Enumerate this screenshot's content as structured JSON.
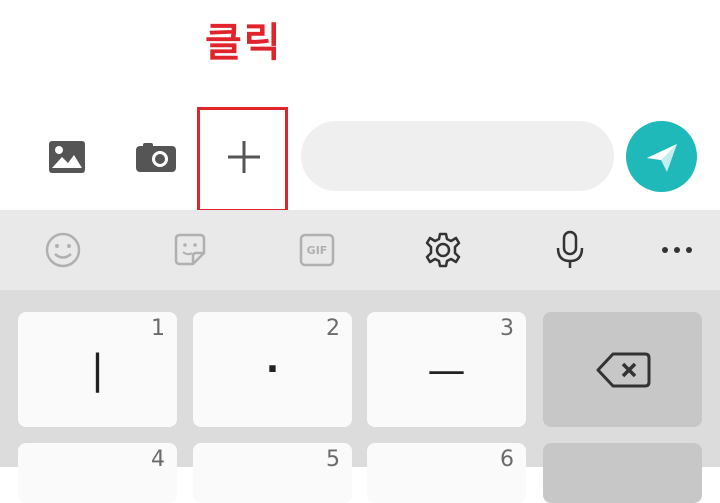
{
  "annotation": {
    "text": "클릭"
  },
  "composer": {
    "icons": [
      "image-icon",
      "camera-icon",
      "plus-icon"
    ],
    "message_placeholder": "",
    "send_icon": "send-icon",
    "accent": "#1fb9b9"
  },
  "keyboard_toolbar": {
    "items": [
      "emoji-icon",
      "sticker-icon",
      "gif-icon",
      "settings-icon",
      "mic-icon",
      "more-icon"
    ],
    "gif_label": "GIF"
  },
  "keys": {
    "row1": [
      {
        "number": "1",
        "glyph": "|"
      },
      {
        "number": "2",
        "glyph": "·"
      },
      {
        "number": "3",
        "glyph": "—"
      }
    ],
    "row2": [
      {
        "number": "4"
      },
      {
        "number": "5"
      },
      {
        "number": "6"
      }
    ]
  },
  "colors": {
    "highlight": "#e0242b"
  }
}
